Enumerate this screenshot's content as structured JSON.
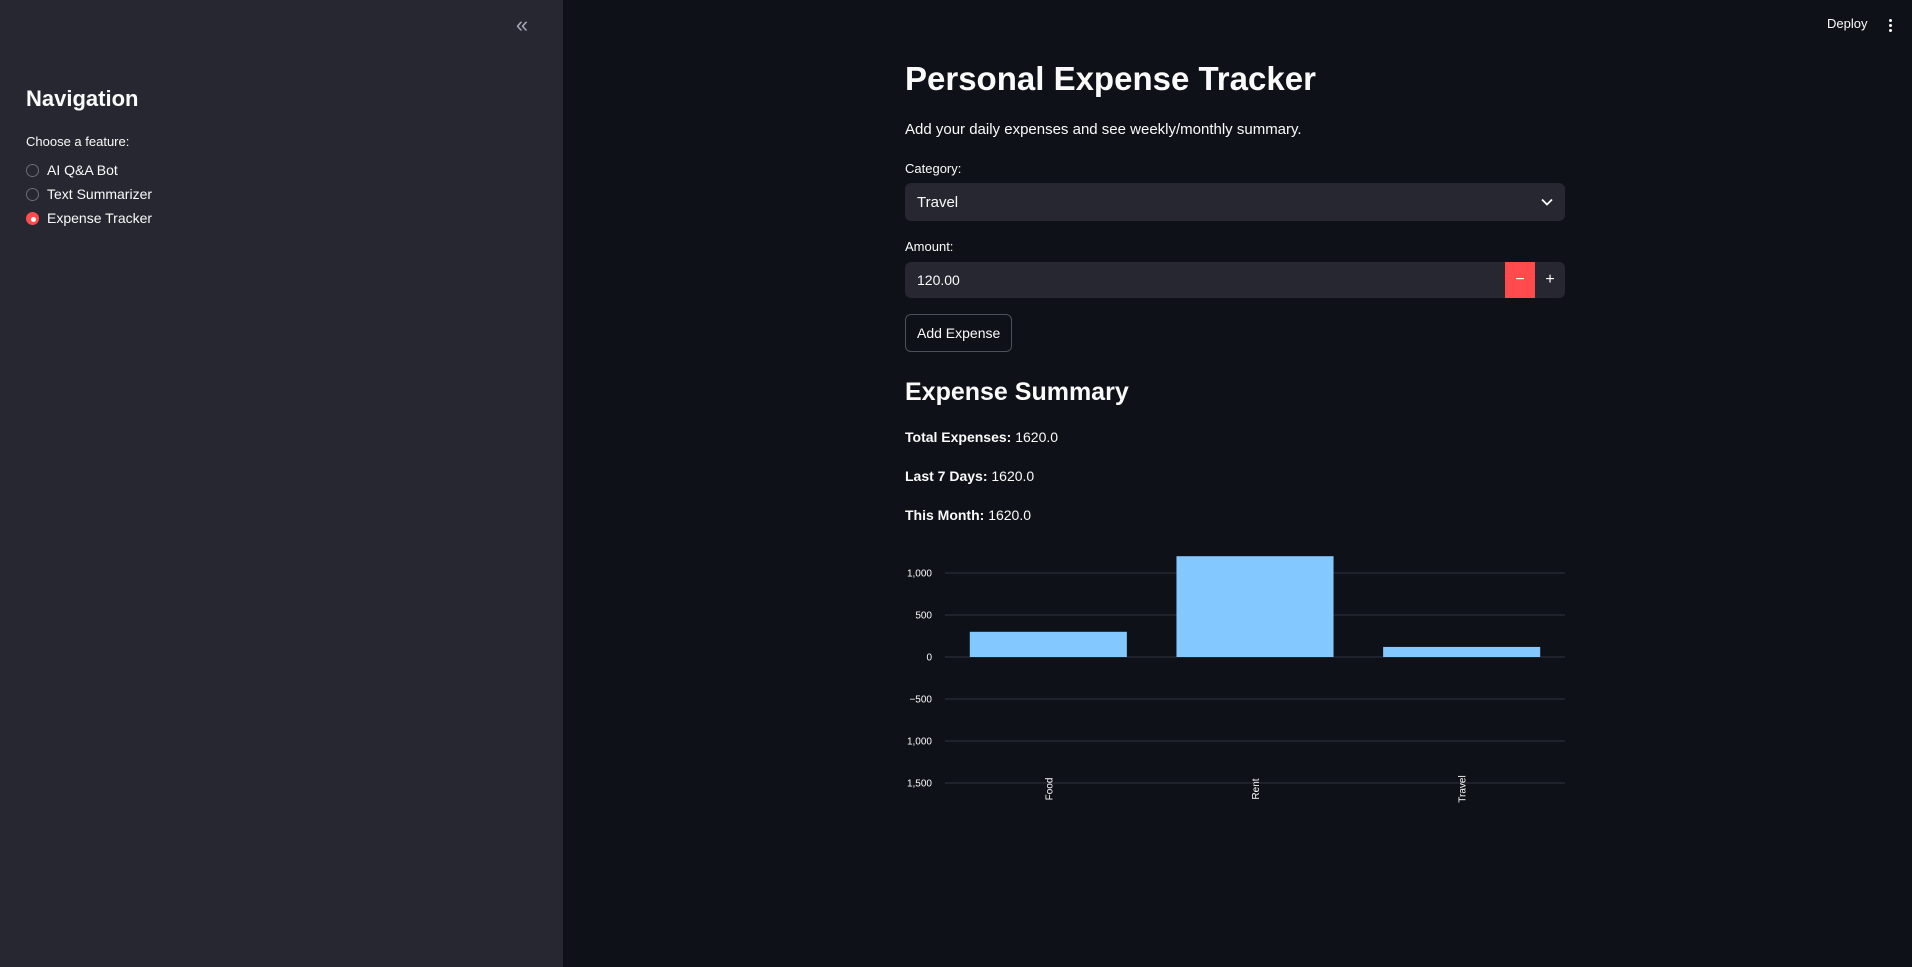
{
  "sidebar": {
    "collapse_icon": "«",
    "title": "Navigation",
    "radio_label": "Choose a feature:",
    "options": [
      {
        "label": "AI Q&A Bot",
        "selected": false
      },
      {
        "label": "Text Summarizer",
        "selected": false
      },
      {
        "label": "Expense Tracker",
        "selected": true
      }
    ]
  },
  "header": {
    "deploy_label": "Deploy",
    "menu_icon": "kebab-menu-icon"
  },
  "main": {
    "title": "Personal Expense Tracker",
    "subtitle": "Add your daily expenses and see weekly/monthly summary.",
    "category_label": "Category:",
    "category_value": "Travel",
    "amount_label": "Amount:",
    "amount_value": "120.00",
    "minus_label": "−",
    "plus_label": "+",
    "add_button_label": "Add Expense",
    "summary_title": "Expense Summary",
    "stats": [
      {
        "label": "Total Expenses:",
        "value": "1620.0"
      },
      {
        "label": "Last 7 Days:",
        "value": "1620.0"
      },
      {
        "label": "This Month:",
        "value": "1620.0"
      }
    ]
  },
  "colors": {
    "accent": "#ff4b4b",
    "bar": "#83c9ff",
    "background": "#0e1117",
    "sidebar": "#262730"
  },
  "chart_data": {
    "type": "bar",
    "categories": [
      "Food",
      "Rent",
      "Travel"
    ],
    "values": [
      300,
      1200,
      120
    ],
    "ylim": [
      -1500,
      1200
    ],
    "yticks": [
      1000,
      500,
      0,
      -500,
      -1000,
      -1500
    ],
    "ytick_labels": [
      "1,000",
      "500",
      "0",
      "−500",
      "1,000",
      "1,500"
    ],
    "grid": true,
    "xlabel": "",
    "ylabel": ""
  }
}
